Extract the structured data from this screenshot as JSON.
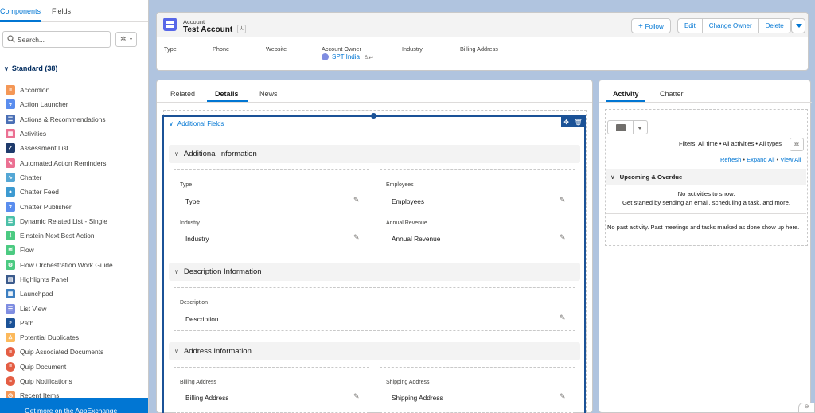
{
  "palette": {
    "tabs": [
      "Components",
      "Fields"
    ],
    "search_placeholder": "Search...",
    "standard_header": "Standard (38)",
    "components": [
      {
        "label": "Accordion",
        "color": "#f49756",
        "icon": "accordion-icon"
      },
      {
        "label": "Action Launcher",
        "color": "#5a8dee",
        "icon": "bolt-icon"
      },
      {
        "label": "Actions & Recommendations",
        "color": "#4a6fb5",
        "icon": "list-icon"
      },
      {
        "label": "Activities",
        "color": "#eb7092",
        "icon": "calendar-icon"
      },
      {
        "label": "Assessment List",
        "color": "#1e3a6b",
        "icon": "checkbox-icon"
      },
      {
        "label": "Automated Action Reminders",
        "color": "#eb7092",
        "icon": "reminder-icon"
      },
      {
        "label": "Chatter",
        "color": "#54a7d5",
        "icon": "chatter-icon"
      },
      {
        "label": "Chatter Feed",
        "color": "#3d9ad1",
        "icon": "chat-bubble-icon"
      },
      {
        "label": "Chatter Publisher",
        "color": "#5a8dee",
        "icon": "bolt-icon"
      },
      {
        "label": "Dynamic Related List - Single",
        "color": "#4bc0a8",
        "icon": "list-icon"
      },
      {
        "label": "Einstein Next Best Action",
        "color": "#4bca81",
        "icon": "download-icon"
      },
      {
        "label": "Flow",
        "color": "#4bca81",
        "icon": "flow-icon"
      },
      {
        "label": "Flow Orchestration Work Guide",
        "color": "#4bca81",
        "icon": "guide-icon"
      },
      {
        "label": "Highlights Panel",
        "color": "#3c5b8c",
        "icon": "panel-icon"
      },
      {
        "label": "Launchpad",
        "color": "#3d7fc1",
        "icon": "grid-icon"
      },
      {
        "label": "List View",
        "color": "#7f8de1",
        "icon": "listview-icon"
      },
      {
        "label": "Path",
        "color": "#1b5297",
        "icon": "path-icon"
      },
      {
        "label": "Potential Duplicates",
        "color": "#fcb95b",
        "icon": "person-icon"
      },
      {
        "label": "Quip Associated Documents",
        "color": "#e45e44",
        "icon": "quip-icon"
      },
      {
        "label": "Quip Document",
        "color": "#e45e44",
        "icon": "quip-icon"
      },
      {
        "label": "Quip Notifications",
        "color": "#e45e44",
        "icon": "quip-icon"
      },
      {
        "label": "Recent Items",
        "color": "#f49756",
        "icon": "clock-icon"
      }
    ],
    "appexchange": "Get more on the AppExchange"
  },
  "record": {
    "object_type": "Account",
    "name": "Test Account",
    "follow": "Follow",
    "actions": [
      "Edit",
      "Change Owner",
      "Delete"
    ],
    "highlights": [
      {
        "label": "Type"
      },
      {
        "label": "Phone"
      },
      {
        "label": "Website"
      },
      {
        "label": "Account Owner",
        "value": "SPT India"
      },
      {
        "label": "Industry"
      },
      {
        "label": "Billing Address"
      }
    ]
  },
  "main": {
    "tabs": [
      "Related",
      "Details",
      "News"
    ],
    "active_tab": "Details",
    "additional_fields": "Additional Fields",
    "sections": [
      {
        "title": "Additional Information",
        "fields": [
          {
            "label": "Type",
            "value": "Type"
          },
          {
            "label": "Employees",
            "value": "Employees"
          },
          {
            "label": "Industry",
            "value": "Industry"
          },
          {
            "label": "Annual Revenue",
            "value": "Annual Revenue"
          }
        ]
      },
      {
        "title": "Description Information",
        "fields": [
          {
            "label": "Description",
            "value": "Description"
          }
        ]
      },
      {
        "title": "Address Information",
        "fields": [
          {
            "label": "Billing Address",
            "value": "Billing Address"
          },
          {
            "label": "Shipping Address",
            "value": "Shipping Address"
          }
        ]
      }
    ]
  },
  "activity": {
    "tabs": [
      "Activity",
      "Chatter"
    ],
    "filters": "Filters: All time • All activities • All types",
    "links": [
      "Refresh",
      "Expand All",
      "View All"
    ],
    "upcoming": "Upcoming & Overdue",
    "no_activities": "No activities to show.",
    "get_started": "Get started by sending an email, scheduling a task, and more.",
    "no_past": "No past activity. Past meetings and tasks marked as done show up here."
  },
  "colors": {
    "brand": "#0176d3",
    "selection": "#1b5297",
    "canvas_bg": "#b0c4df"
  }
}
